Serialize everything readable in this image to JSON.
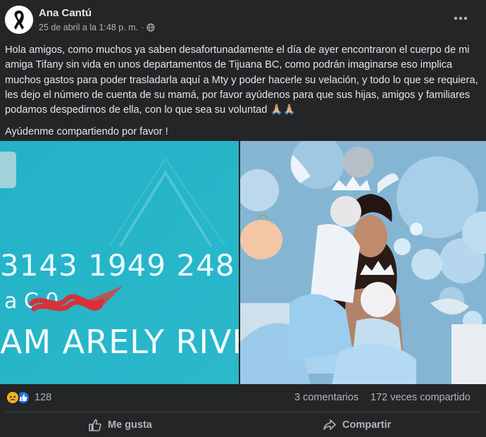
{
  "post": {
    "author": "Ana Cantú",
    "timestamp": "25 de abril a la 1:48 p. m.",
    "separator": "·",
    "paragraph_1": "Hola amigos, como muchos ya saben desafortunadamente el día de ayer encontraron el cuerpo de mi amiga Tifany sin vida en unos departamentos de Tijuana BC, como podrán imaginarse eso implica muchos gastos para poder trasladarla aquí a Mty y poder hacerle su velación, y todo lo que se requiera, les dejo el número de cuenta de su mamá, por favor ayúdenos para que sus hijas, amigos y familiares podamos despedirnos de ella, con lo que sea su voluntad 🙏🏼🙏🏼",
    "paragraph_2": "Ayúdenme compartiendo por favor !",
    "card_image": {
      "number": "3143 1949 248",
      "code": "a C    0",
      "name": "AM ARELY RIVE"
    },
    "reaction_count": "128",
    "comments_label": "3 comentarios",
    "shares_label": "172 veces compartido",
    "like_label": "Me gusta",
    "share_label": "Compartir"
  },
  "colors": {
    "background": "#242526",
    "primary_text": "#e4e6eb",
    "secondary_text": "#b0b3b8",
    "divider": "#3e4042",
    "like_blue": "#1b74e4",
    "sad_yellow": "#f7b125",
    "card_teal": "#29b5c8"
  },
  "icons": [
    "black-ribbon-avatar",
    "globe-icon",
    "more-dots-icon",
    "sad-reaction-icon",
    "like-reaction-icon",
    "thumbs-up-icon",
    "share-arrow-icon"
  ]
}
